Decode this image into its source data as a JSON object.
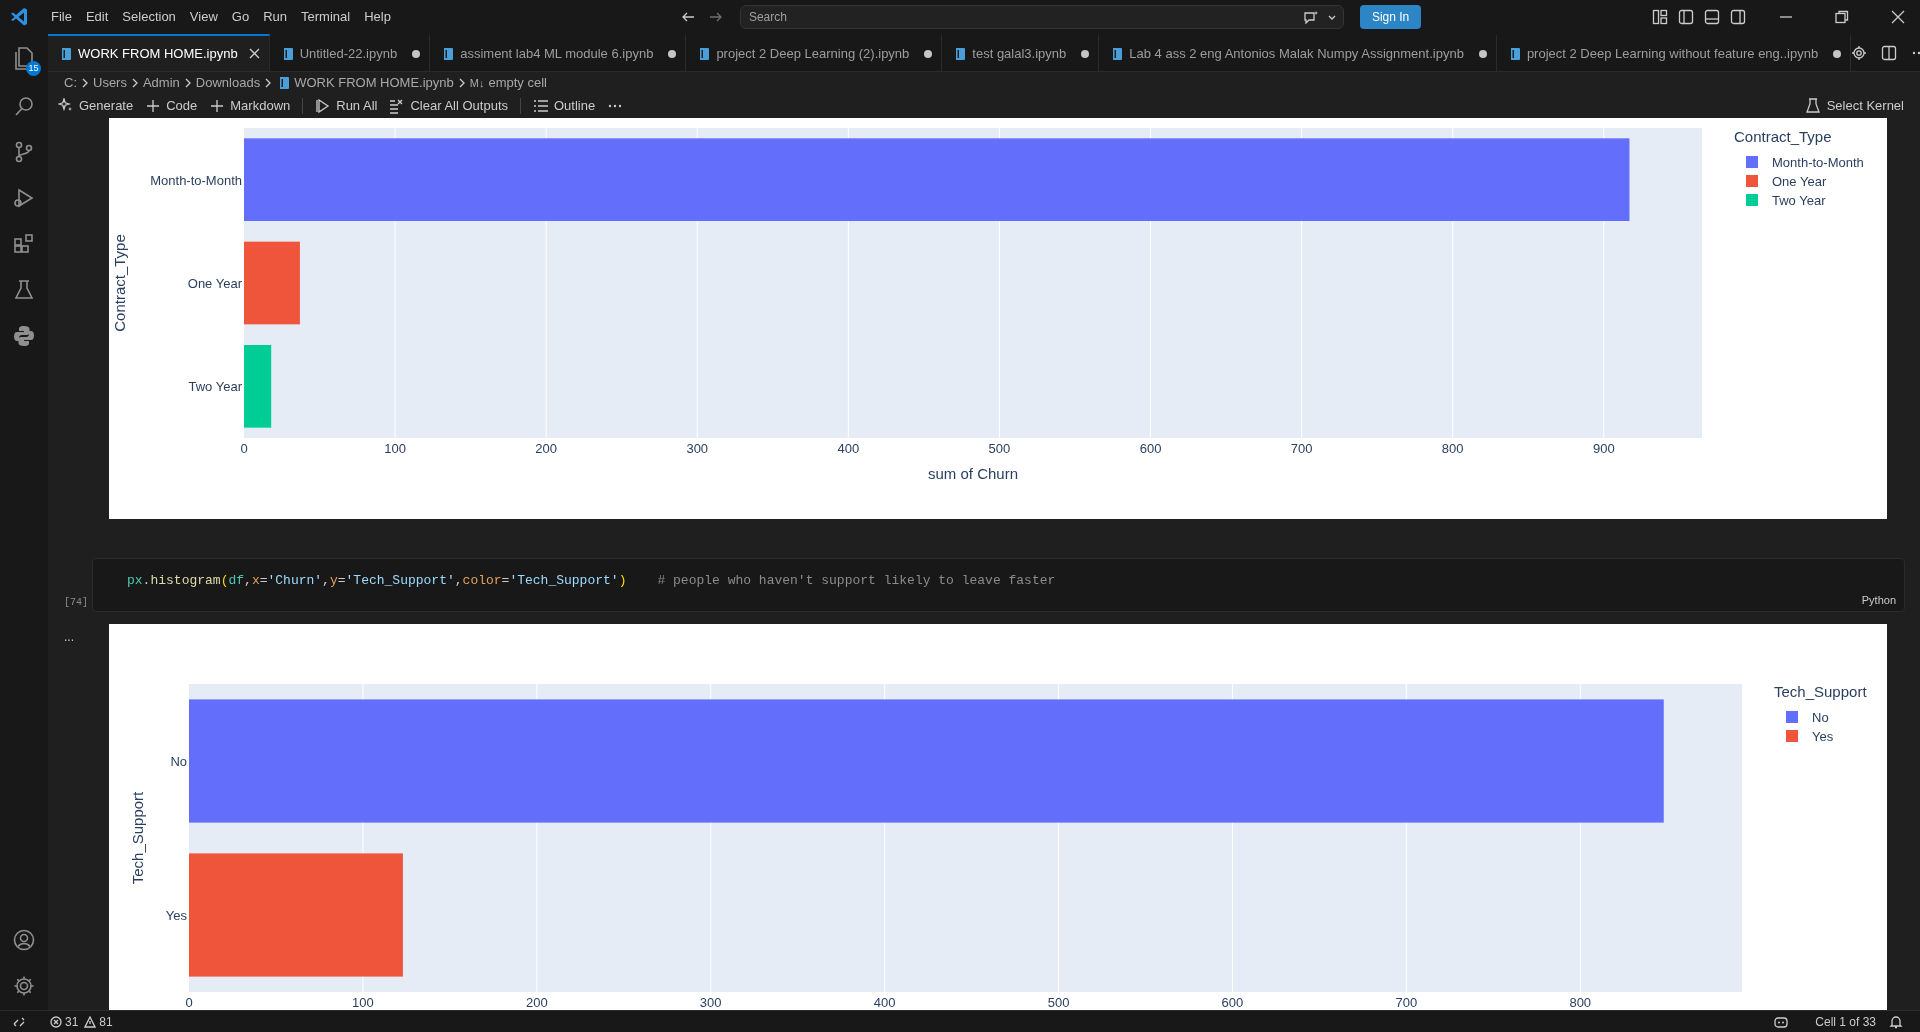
{
  "title_bar": {
    "menu": [
      "File",
      "Edit",
      "Selection",
      "View",
      "Go",
      "Run",
      "Terminal",
      "Help"
    ],
    "search": {
      "placeholder": "Search"
    },
    "sign_in": "Sign In"
  },
  "activity_bar": {
    "explorer_badge": "15"
  },
  "tabs": [
    {
      "label": "WORK FROM HOME.ipynb",
      "selected": true,
      "modified": false
    },
    {
      "label": "Untitled-22.ipynb",
      "selected": false,
      "modified": true
    },
    {
      "label": "assiment lab4 ML module 6.ipynb",
      "selected": false,
      "modified": true
    },
    {
      "label": "project 2 Deep Learning (2).ipynb",
      "selected": false,
      "modified": true
    },
    {
      "label": "test galal3.ipynb",
      "selected": false,
      "modified": true
    },
    {
      "label": "Lab 4 ass 2 eng Antonios Malak Numpy Assignment.ipynb",
      "selected": false,
      "modified": true
    },
    {
      "label": "project 2 Deep Learning without feature eng..ipynb",
      "selected": false,
      "modified": true
    }
  ],
  "breadcrumb": [
    {
      "kind": "folder",
      "label": "C:"
    },
    {
      "kind": "folder",
      "label": "Users"
    },
    {
      "kind": "folder",
      "label": "Admin"
    },
    {
      "kind": "folder",
      "label": "Downloads"
    },
    {
      "kind": "file",
      "label": "WORK FROM HOME.ipynb"
    },
    {
      "kind": "cell",
      "prefix": "M↓",
      "label": "empty cell"
    }
  ],
  "toolbar": {
    "items": [
      {
        "kind": "sparkle",
        "label": "Generate"
      },
      {
        "kind": "plus",
        "label": "Code"
      },
      {
        "kind": "plus",
        "label": "Markdown"
      },
      {
        "kind": "run",
        "label": "Run All"
      },
      {
        "kind": "clear",
        "label": "Clear All Outputs"
      },
      {
        "kind": "outline",
        "label": "Outline"
      },
      {
        "kind": "more"
      }
    ],
    "kernel": "Select Kernel"
  },
  "outputs": [
    {
      "chart_data": {
        "type": "bar",
        "orientation": "h",
        "xlabel": "sum of Churn",
        "ylabel": "Contract_Type",
        "legend_title": "Contract_Type",
        "categories": [
          "Month-to-Month",
          "One Year",
          "Two Year"
        ],
        "series": [
          {
            "name": "Month-to-Month",
            "color": "#636efa",
            "values": [
              917,
              null,
              null
            ]
          },
          {
            "name": "One Year",
            "color": "#ef553b",
            "values": [
              null,
              37,
              null
            ]
          },
          {
            "name": "Two Year",
            "color": "#00cc96",
            "values": [
              null,
              null,
              18
            ]
          }
        ],
        "xlim": [
          0,
          965
        ],
        "xticks": [
          0,
          100,
          200,
          300,
          400,
          500,
          600,
          700,
          800,
          900
        ],
        "grid": true,
        "legend": true
      }
    }
  ],
  "cell": {
    "execution_count": "[74]",
    "code": [
      {
        "kind": "var",
        "text": "px"
      },
      {
        "kind": "punct",
        "text": "."
      },
      {
        "kind": "func",
        "text": "histogram"
      },
      {
        "kind": "paren",
        "text": "("
      },
      {
        "kind": "var",
        "text": "df"
      },
      {
        "kind": "punct",
        "text": ","
      },
      {
        "kind": "param",
        "text": "x"
      },
      {
        "kind": "op",
        "text": "="
      },
      {
        "kind": "string",
        "text": "'Churn'"
      },
      {
        "kind": "punct",
        "text": ","
      },
      {
        "kind": "param",
        "text": "y"
      },
      {
        "kind": "op",
        "text": "="
      },
      {
        "kind": "string",
        "text": "'Tech_Support'"
      },
      {
        "kind": "punct",
        "text": ","
      },
      {
        "kind": "param",
        "text": "color"
      },
      {
        "kind": "op",
        "text": "="
      },
      {
        "kind": "string",
        "text": "'Tech_Support'"
      },
      {
        "kind": "paren",
        "text": ")"
      },
      {
        "kind": "comment",
        "text": "# people who haven't support likely to leave faster"
      }
    ],
    "language": "Python",
    "output_more": "..."
  },
  "cell_output": {
    "chart_data": {
      "type": "bar",
      "orientation": "h",
      "ylabel": "Tech_Support",
      "legend_title": "Tech_Support",
      "categories": [
        "No",
        "Yes"
      ],
      "series": [
        {
          "name": "No",
          "color": "#636efa",
          "values": [
            848,
            null
          ]
        },
        {
          "name": "Yes",
          "color": "#ef553b",
          "values": [
            null,
            123
          ]
        }
      ],
      "xlim": [
        0,
        893
      ],
      "xticks": [
        0,
        100,
        200,
        300,
        400,
        500,
        600,
        700,
        800
      ],
      "grid": true,
      "legend": true
    }
  },
  "status_bar": {
    "errors": "31",
    "warnings": "81",
    "cell_position": "Cell 1 of 33"
  }
}
